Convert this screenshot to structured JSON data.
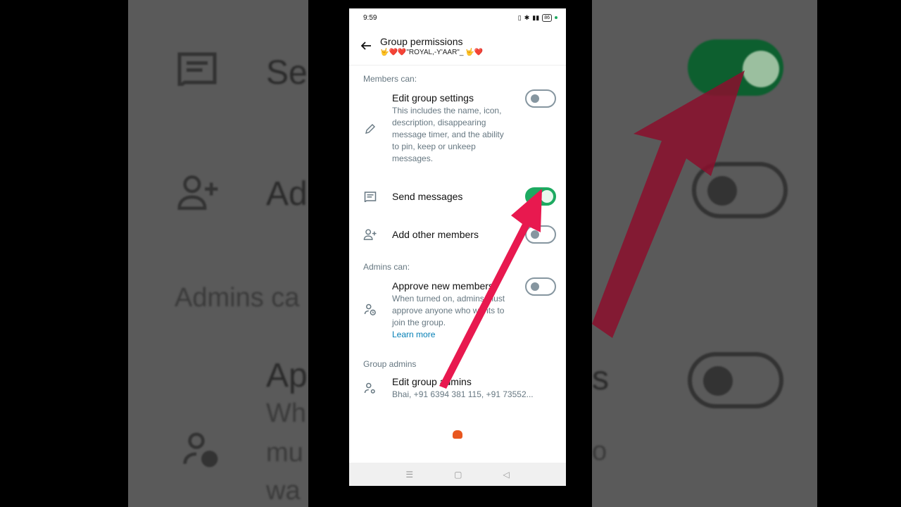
{
  "status_bar": {
    "time": "9:59",
    "battery": "86"
  },
  "header": {
    "title": "Group permissions",
    "group_name": "🤟❤️❤️\"ROYAL,-Y'AAR\"_ 🤟❤️"
  },
  "members_section": {
    "label": "Members can:",
    "items": [
      {
        "title": "Edit group settings",
        "description": "This includes the name, icon, description, disappearing message timer, and the ability to pin, keep or unkeep messages.",
        "enabled": false
      },
      {
        "title": "Send messages",
        "enabled": true
      },
      {
        "title": "Add other members",
        "enabled": false
      }
    ]
  },
  "admins_section": {
    "label": "Admins can:",
    "items": [
      {
        "title": "Approve new members",
        "description": "When turned on, admins must approve anyone who wants to join the group.",
        "link": "Learn more",
        "enabled": false
      }
    ]
  },
  "group_admins": {
    "label": "Group admins",
    "title": "Edit group admins",
    "members": "Bhai, +91 6394 381 115, +91 73552..."
  },
  "background_zoom": {
    "texts": [
      "Se",
      "Ad",
      "Admins ca",
      "Ap",
      "Wh",
      "mu",
      "wa",
      "s",
      "o"
    ]
  },
  "colors": {
    "toggle_on": "#1daa61",
    "toggle_off": "#8696a0",
    "link": "#027eb5",
    "arrow": "#e8194f"
  }
}
